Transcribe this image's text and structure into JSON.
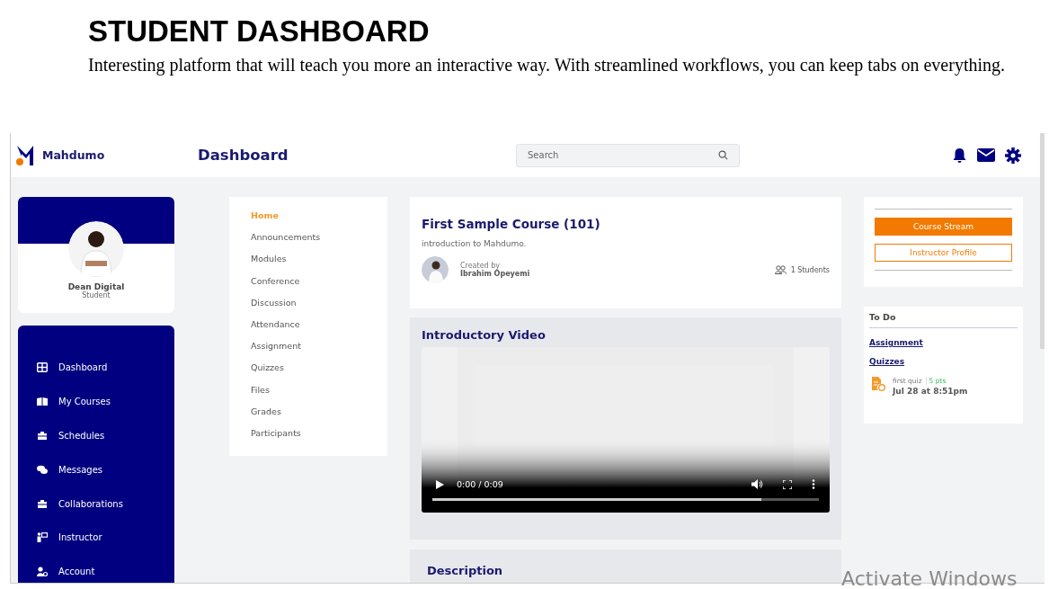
{
  "page": {
    "heading": "STUDENT DASHBOARD",
    "intro": "Interesting platform that will teach you more an interactive way. With streamlined workflows, you can keep tabs on everything."
  },
  "header": {
    "brand": "Mahdumo",
    "title": "Dashboard",
    "search": {
      "placeholder": "Search"
    }
  },
  "profile": {
    "name": "Dean Digital",
    "role": "Student"
  },
  "sidebar": {
    "items": [
      {
        "label": "Dashboard"
      },
      {
        "label": "My Courses"
      },
      {
        "label": "Schedules"
      },
      {
        "label": "Messages"
      },
      {
        "label": "Collaborations"
      },
      {
        "label": "Instructor"
      },
      {
        "label": "Account"
      }
    ]
  },
  "course_menu": {
    "items": [
      {
        "label": "Home",
        "selected": true
      },
      {
        "label": "Announcements",
        "selected": false
      },
      {
        "label": "Modules",
        "selected": false
      },
      {
        "label": "Conference",
        "selected": false
      },
      {
        "label": "Discussion",
        "selected": false
      },
      {
        "label": "Attendance",
        "selected": false
      },
      {
        "label": "Assignment",
        "selected": false
      },
      {
        "label": "Quizzes",
        "selected": false
      },
      {
        "label": "Files",
        "selected": false
      },
      {
        "label": "Grades",
        "selected": false
      },
      {
        "label": "Participants",
        "selected": false
      }
    ]
  },
  "course": {
    "title": "First Sample Course (101)",
    "description": "introduction to Mahdumo.",
    "created_by_label": "Created by",
    "creator": "Ibrahim Opeyemi",
    "students": "1 Students"
  },
  "video": {
    "title": "Introductory Video",
    "time": "0:00 / 0:09",
    "level": 0.85
  },
  "description": {
    "title": "Description"
  },
  "actions": {
    "buttons": [
      {
        "label": "Course Stream",
        "kind": "filled"
      },
      {
        "label": "Instructor Profile",
        "kind": "outline"
      }
    ]
  },
  "todo": {
    "title": "To Do",
    "links": [
      "Assignment",
      "Quizzes"
    ],
    "items": [
      {
        "name": "first quiz",
        "points": "5 pts",
        "due": "Jul 28 at 8:51pm"
      }
    ]
  },
  "os_overlay": "Activate Windows"
}
